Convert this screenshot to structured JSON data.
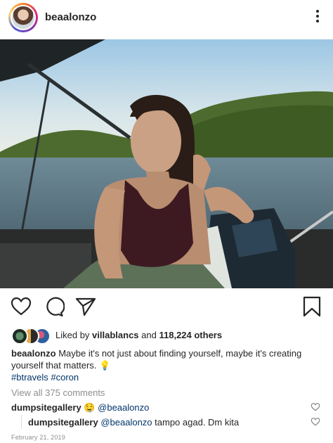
{
  "post": {
    "author": "beaalonzo",
    "liked_by_prefix": "Liked by",
    "liked_by_user": "villablancs",
    "likes_middle": "and",
    "likes_count": "118,224 others",
    "caption_user": "beaalonzo",
    "caption_text": "Maybe it's not just about finding yourself, maybe it's creating yourself that matters.",
    "caption_emoji": "💡",
    "hashtags": "#btravels #coron",
    "view_all_comments": "View all 375 comments",
    "comments": [
      {
        "user": "dumpsitegallery",
        "emoji": "🤤",
        "mention": "@beaalonzo",
        "text": ""
      },
      {
        "user": "dumpsitegallery",
        "mention": "@beaalonzo",
        "text": "tampo agad. Dm kita"
      }
    ],
    "date": "February 21, 2019"
  },
  "icons": {
    "more": "more-vertical-icon",
    "like": "heart-icon",
    "comment": "comment-icon",
    "share": "share-icon",
    "save": "bookmark-icon"
  },
  "colors": {
    "link": "#003569",
    "muted": "#8e8e8e",
    "text": "#262626"
  }
}
